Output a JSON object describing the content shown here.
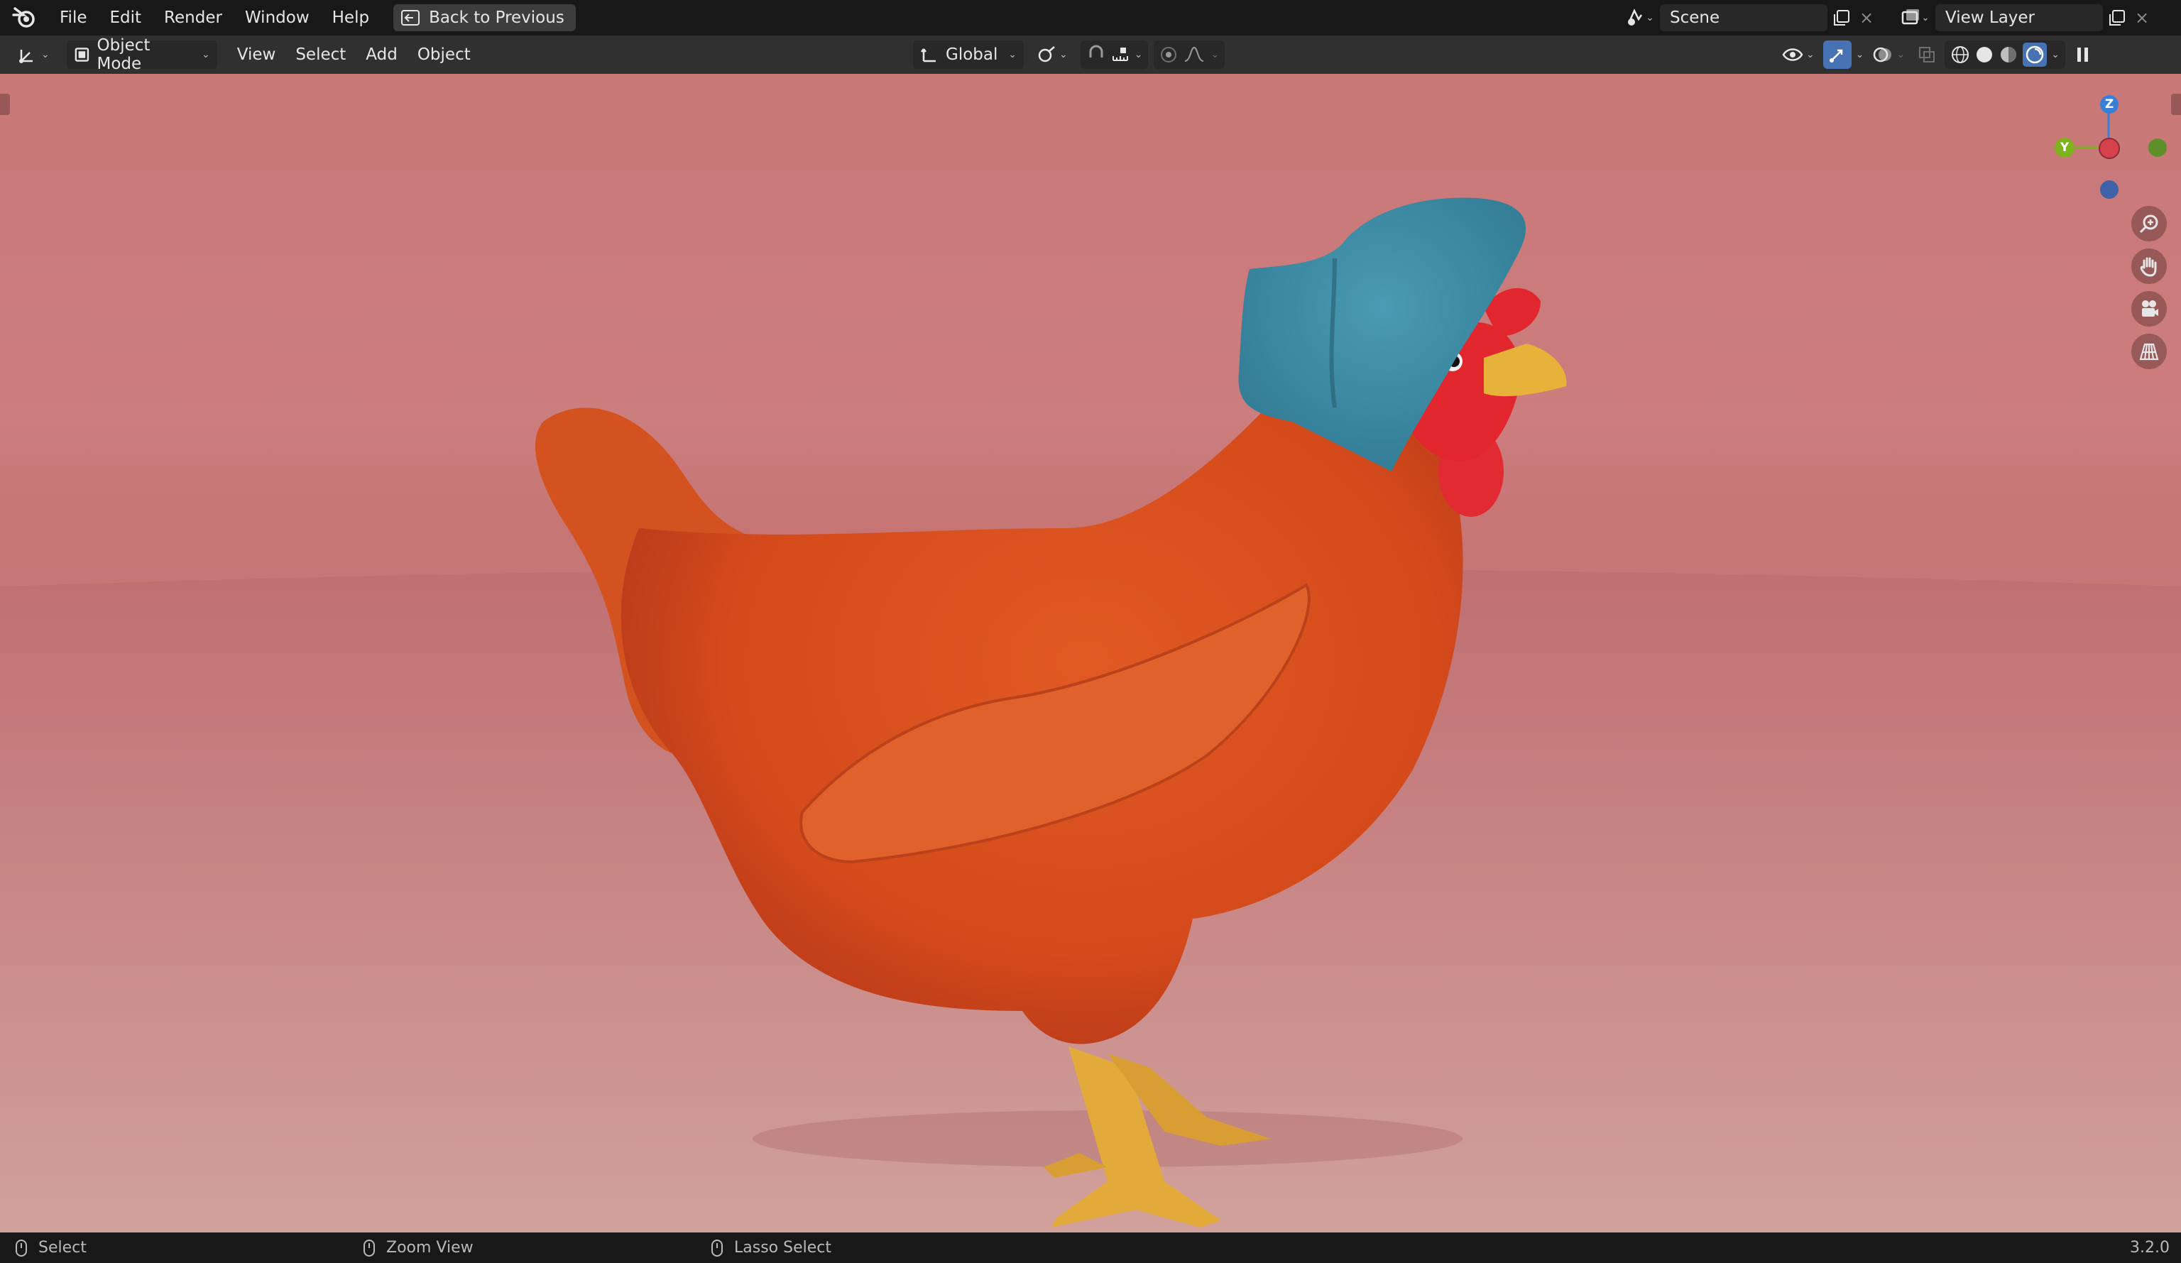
{
  "topbar": {
    "menus": [
      "File",
      "Edit",
      "Render",
      "Window",
      "Help"
    ],
    "back_button": "Back to Previous",
    "scene_name": "Scene",
    "view_layer_name": "View Layer"
  },
  "header": {
    "mode": "Object Mode",
    "menus": [
      "View",
      "Select",
      "Add",
      "Object"
    ],
    "transform_orientation": "Global"
  },
  "gizmo": {
    "z": "Z",
    "y": "Y"
  },
  "statusbar": {
    "left_click": "Select",
    "middle_click": "Zoom View",
    "right_click": "Lasso Select",
    "version": "3.2.0"
  },
  "colors": {
    "viewport_bg": "#c97878",
    "chicken_body": "#d84a1c",
    "hat": "#3f8fa8",
    "comb": "#e02a2f",
    "legs": "#e8b23f",
    "x_axis": "#e64a56",
    "y_axis": "#7fb31e",
    "z_axis": "#3a7fd6",
    "active_blue": "#4772b3"
  }
}
